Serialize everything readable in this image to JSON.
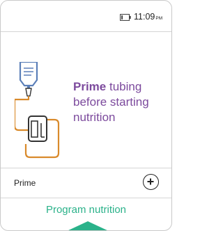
{
  "status_bar": {
    "time": "11:09",
    "ampm": "PM",
    "battery_icon": "battery-low-icon"
  },
  "main": {
    "instruction_bold": "Prime",
    "instruction_rest": " tubing before starting nutrition",
    "illustration_icon": "feeding-bag-pump-icon"
  },
  "prime_row": {
    "label": "Prime",
    "button_icon": "plus-circle-icon"
  },
  "footer": {
    "program_label": "Program nutrition",
    "arrow_icon": "chevron-up-icon"
  },
  "colors": {
    "accent_purple": "#7c4a9d",
    "accent_green": "#2bb28a",
    "tubing_orange": "#d98a2b",
    "bag_blue": "#5b7fb8"
  }
}
